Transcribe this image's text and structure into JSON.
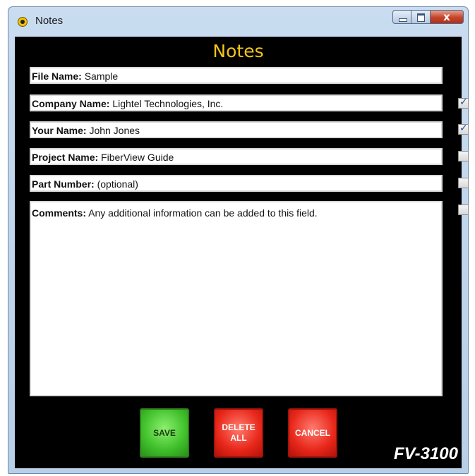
{
  "window": {
    "title": "Notes",
    "app_icon": "app-icon",
    "close_glyph": "x"
  },
  "heading": "Notes",
  "fields": [
    {
      "label": "File Name:",
      "value": "Sample",
      "checked": null
    },
    {
      "label": "Company Name:",
      "value": "Lightel Technologies, Inc.",
      "checked": true
    },
    {
      "label": "Your Name:",
      "value": "John Jones",
      "checked": true
    },
    {
      "label": "Project Name:",
      "value": "FiberView Guide",
      "checked": false
    },
    {
      "label": "Part Number:",
      "value": "(optional)",
      "checked": false
    },
    {
      "label": "Comments:",
      "value": "Any additional information can be added to this field.",
      "checked": false
    }
  ],
  "buttons": {
    "save": "SAVE",
    "delete_all": "DELETE\nALL",
    "cancel": "CANCEL"
  },
  "model": "FV-3100",
  "colors": {
    "heading": "#f5c518",
    "save": "#3fbf2a",
    "delete": "#e8271a",
    "cancel": "#e8271a",
    "background": "#000000"
  }
}
